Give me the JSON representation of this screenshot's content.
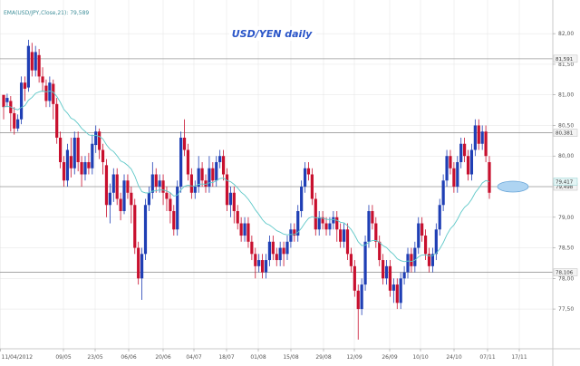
{
  "chart_data": {
    "type": "candlestick",
    "title": "USD/YEN daily",
    "indicator_legend": "EMA(USD/JPY,Close,21): 79,589",
    "ylim": [
      76.85,
      82.55
    ],
    "y_ticks": [
      "82,00",
      "81,50",
      "81,00",
      "80,50",
      "80,00",
      "79,50",
      "79,00",
      "78,50",
      "78,00",
      "77,50"
    ],
    "y_tick_values": [
      82.0,
      81.5,
      81.0,
      80.5,
      80.0,
      79.5,
      79.0,
      78.5,
      78.0,
      77.5
    ],
    "x_ticks": [
      "11/04/2012",
      "09/05",
      "23/05",
      "06/06",
      "20/06",
      "04/07",
      "18/07",
      "01/08",
      "15/08",
      "29/08",
      "12/09",
      "26/09",
      "10/10",
      "24/10",
      "07/11",
      "17/11"
    ],
    "horizontal_levels": [
      {
        "value": 81.59,
        "tag": "81,591"
      },
      {
        "value": 80.38,
        "tag": "80,381"
      },
      {
        "value": 79.5,
        "tag": "79,498"
      },
      {
        "value": 78.1,
        "tag": "78,106"
      }
    ],
    "ema_tag": "79,417",
    "highlight_level": 79.5,
    "colors": {
      "up": "#1f3fb5",
      "down": "#c8102e",
      "ema": "#5ec8c8",
      "level": "#999999",
      "grid": "#e3e3e3"
    },
    "candles": [
      [
        81.0,
        80.8,
        80.9,
        80.6
      ],
      [
        80.88,
        80.95,
        81.02,
        80.8
      ],
      [
        80.9,
        80.7,
        80.98,
        80.4
      ],
      [
        80.7,
        80.45,
        80.8,
        80.35
      ],
      [
        80.45,
        80.6,
        80.68,
        80.4
      ],
      [
        80.6,
        81.2,
        81.3,
        80.52
      ],
      [
        81.2,
        81.1,
        81.3,
        80.9
      ],
      [
        81.12,
        81.8,
        81.9,
        81.05
      ],
      [
        81.7,
        81.4,
        81.85,
        81.3
      ],
      [
        81.4,
        81.7,
        81.8,
        81.3
      ],
      [
        81.65,
        81.3,
        81.75,
        81.2
      ],
      [
        81.3,
        81.2,
        81.45,
        81.05
      ],
      [
        81.15,
        80.9,
        81.25,
        80.8
      ],
      [
        80.9,
        81.2,
        81.3,
        80.8
      ],
      [
        81.18,
        80.85,
        81.25,
        80.6
      ],
      [
        80.85,
        80.3,
        80.95,
        80.2
      ],
      [
        80.3,
        79.9,
        80.4,
        79.8
      ],
      [
        79.9,
        79.6,
        80.0,
        79.5
      ],
      [
        79.6,
        80.1,
        80.2,
        79.5
      ],
      [
        80.0,
        79.8,
        80.3,
        79.65
      ],
      [
        79.8,
        80.3,
        80.4,
        79.7
      ],
      [
        80.3,
        79.9,
        80.4,
        79.75
      ],
      [
        79.9,
        79.7,
        80.0,
        79.5
      ],
      [
        79.7,
        79.9,
        80.0,
        79.6
      ],
      [
        79.9,
        79.8,
        80.05,
        79.7
      ],
      [
        79.8,
        80.2,
        80.35,
        79.7
      ],
      [
        80.18,
        80.4,
        80.5,
        80.05
      ],
      [
        80.4,
        80.1,
        80.45,
        79.95
      ],
      [
        80.1,
        79.9,
        80.2,
        79.7
      ],
      [
        79.85,
        79.2,
        79.95,
        79.0
      ],
      [
        79.2,
        79.4,
        79.55,
        78.9
      ],
      [
        79.4,
        79.7,
        79.8,
        79.25
      ],
      [
        79.7,
        79.3,
        79.8,
        79.2
      ],
      [
        79.3,
        79.1,
        79.4,
        78.95
      ],
      [
        79.1,
        79.6,
        79.7,
        79.05
      ],
      [
        79.6,
        79.4,
        79.7,
        79.3
      ],
      [
        79.4,
        79.2,
        79.5,
        78.9
      ],
      [
        79.2,
        78.5,
        79.3,
        78.4
      ],
      [
        78.5,
        78.0,
        78.6,
        77.9
      ],
      [
        78.0,
        78.4,
        78.5,
        77.65
      ],
      [
        78.4,
        79.2,
        79.3,
        78.3
      ],
      [
        79.2,
        79.4,
        79.5,
        79.1
      ],
      [
        79.4,
        79.7,
        79.9,
        79.3
      ],
      [
        79.7,
        79.5,
        79.8,
        79.4
      ],
      [
        79.5,
        79.6,
        79.7,
        79.4
      ],
      [
        79.6,
        79.4,
        79.7,
        79.2
      ],
      [
        79.4,
        79.3,
        79.5,
        79.1
      ],
      [
        79.3,
        79.1,
        79.4,
        78.9
      ],
      [
        79.1,
        78.8,
        79.2,
        78.7
      ],
      [
        78.8,
        79.5,
        79.6,
        78.7
      ],
      [
        79.5,
        80.3,
        80.4,
        79.4
      ],
      [
        80.3,
        80.1,
        80.6,
        80.0
      ],
      [
        80.1,
        79.7,
        80.2,
        79.6
      ],
      [
        79.7,
        79.4,
        79.8,
        79.3
      ],
      [
        79.4,
        79.5,
        79.6,
        79.3
      ],
      [
        79.5,
        79.8,
        80.0,
        79.4
      ],
      [
        79.8,
        79.6,
        79.9,
        79.5
      ],
      [
        79.6,
        79.5,
        79.7,
        79.4
      ],
      [
        79.5,
        79.8,
        80.0,
        79.4
      ],
      [
        79.8,
        79.6,
        79.9,
        79.5
      ],
      [
        79.6,
        79.9,
        80.0,
        79.5
      ],
      [
        79.9,
        80.0,
        80.1,
        79.8
      ],
      [
        80.0,
        79.7,
        80.1,
        79.6
      ],
      [
        79.7,
        79.2,
        79.8,
        79.1
      ],
      [
        79.2,
        79.4,
        79.5,
        79.0
      ],
      [
        79.4,
        79.1,
        79.5,
        78.9
      ],
      [
        79.1,
        78.9,
        79.2,
        78.8
      ],
      [
        78.9,
        78.7,
        79.0,
        78.6
      ],
      [
        78.7,
        78.9,
        79.0,
        78.6
      ],
      [
        78.9,
        78.6,
        79.0,
        78.5
      ],
      [
        78.6,
        78.4,
        78.7,
        78.3
      ],
      [
        78.4,
        78.2,
        78.5,
        78.0
      ],
      [
        78.2,
        78.3,
        78.4,
        78.1
      ],
      [
        78.3,
        78.1,
        78.4,
        78.0
      ],
      [
        78.1,
        78.3,
        78.4,
        78.0
      ],
      [
        78.3,
        78.6,
        78.7,
        78.2
      ],
      [
        78.6,
        78.4,
        78.7,
        78.3
      ],
      [
        78.4,
        78.3,
        78.5,
        78.2
      ],
      [
        78.3,
        78.5,
        78.6,
        78.2
      ],
      [
        78.5,
        78.4,
        78.6,
        78.2
      ],
      [
        78.4,
        78.6,
        78.7,
        78.3
      ],
      [
        78.6,
        78.8,
        78.9,
        78.5
      ],
      [
        78.8,
        78.7,
        78.9,
        78.6
      ],
      [
        78.7,
        79.1,
        79.2,
        78.6
      ],
      [
        79.1,
        79.5,
        79.6,
        79.0
      ],
      [
        79.5,
        79.8,
        79.9,
        79.4
      ],
      [
        79.8,
        79.7,
        79.9,
        79.6
      ],
      [
        79.7,
        79.3,
        79.8,
        79.2
      ],
      [
        79.3,
        78.8,
        79.4,
        78.7
      ],
      [
        78.8,
        79.0,
        79.1,
        78.7
      ],
      [
        79.0,
        78.9,
        79.1,
        78.8
      ],
      [
        78.9,
        78.8,
        79.0,
        78.7
      ],
      [
        78.8,
        78.9,
        79.0,
        78.7
      ],
      [
        78.9,
        79.0,
        79.1,
        78.8
      ],
      [
        79.0,
        78.8,
        79.1,
        78.6
      ],
      [
        78.8,
        78.6,
        78.9,
        78.5
      ],
      [
        78.6,
        78.8,
        78.9,
        78.5
      ],
      [
        78.8,
        78.4,
        78.9,
        78.3
      ],
      [
        78.4,
        78.2,
        78.5,
        78.1
      ],
      [
        78.2,
        77.8,
        78.3,
        77.7
      ],
      [
        77.8,
        77.5,
        77.9,
        77.0
      ],
      [
        77.5,
        77.9,
        78.0,
        77.4
      ],
      [
        77.9,
        78.6,
        78.7,
        77.8
      ],
      [
        78.6,
        79.1,
        79.2,
        78.5
      ],
      [
        79.1,
        78.9,
        79.2,
        78.8
      ],
      [
        78.9,
        78.6,
        79.0,
        78.5
      ],
      [
        78.6,
        78.3,
        78.7,
        78.2
      ],
      [
        78.3,
        78.0,
        78.4,
        77.9
      ],
      [
        78.0,
        78.2,
        78.3,
        77.9
      ],
      [
        78.2,
        77.8,
        78.3,
        77.7
      ],
      [
        77.8,
        77.9,
        78.0,
        77.6
      ],
      [
        77.9,
        77.6,
        78.0,
        77.5
      ],
      [
        77.6,
        78.0,
        78.1,
        77.5
      ],
      [
        78.0,
        78.1,
        78.2,
        77.9
      ],
      [
        78.1,
        78.4,
        78.5,
        78.0
      ],
      [
        78.4,
        78.2,
        78.5,
        78.1
      ],
      [
        78.2,
        78.5,
        78.6,
        78.1
      ],
      [
        78.5,
        78.9,
        79.0,
        78.4
      ],
      [
        78.9,
        78.7,
        79.0,
        78.6
      ],
      [
        78.7,
        78.4,
        78.8,
        78.3
      ],
      [
        78.4,
        78.2,
        78.5,
        78.1
      ],
      [
        78.2,
        78.4,
        78.5,
        78.1
      ],
      [
        78.4,
        78.8,
        78.9,
        78.3
      ],
      [
        78.8,
        79.2,
        79.3,
        78.7
      ],
      [
        79.2,
        79.6,
        79.7,
        79.1
      ],
      [
        79.6,
        80.0,
        80.1,
        79.5
      ],
      [
        80.0,
        79.8,
        80.1,
        79.7
      ],
      [
        79.8,
        79.5,
        79.9,
        79.4
      ],
      [
        79.5,
        79.9,
        80.0,
        79.4
      ],
      [
        79.9,
        80.2,
        80.3,
        79.8
      ],
      [
        80.2,
        80.0,
        80.3,
        79.9
      ],
      [
        80.0,
        79.7,
        80.1,
        79.6
      ],
      [
        79.7,
        80.1,
        80.2,
        79.6
      ],
      [
        80.1,
        80.5,
        80.6,
        80.0
      ],
      [
        80.5,
        80.2,
        80.6,
        80.1
      ],
      [
        80.2,
        80.4,
        80.5,
        80.1
      ],
      [
        80.4,
        80.0,
        80.5,
        79.9
      ],
      [
        79.9,
        79.4,
        80.0,
        79.3
      ]
    ]
  }
}
